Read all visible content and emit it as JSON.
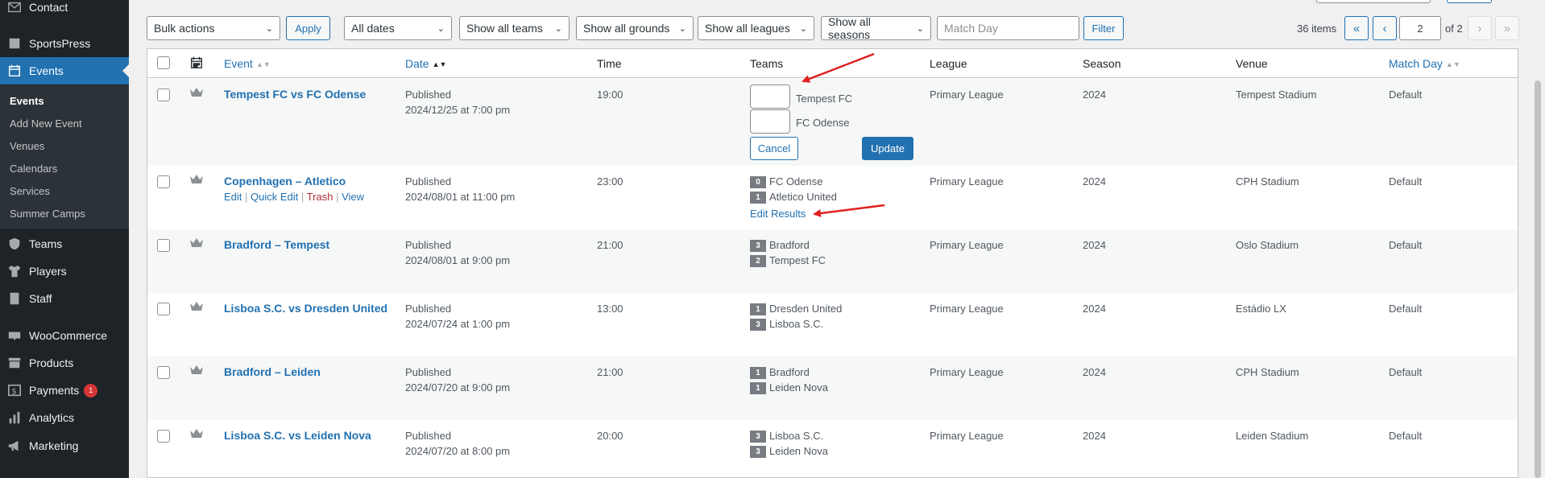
{
  "sidebar": {
    "items": [
      {
        "label": "Contact",
        "icon": "mail-icon"
      },
      {
        "label": "SportsPress",
        "icon": "sportspress-icon"
      },
      {
        "label": "Events",
        "icon": "calendar-icon"
      },
      {
        "label": "Teams",
        "icon": "shield-icon"
      },
      {
        "label": "Players",
        "icon": "shirt-icon"
      },
      {
        "label": "Staff",
        "icon": "id-card-icon"
      },
      {
        "label": "WooCommerce",
        "icon": "woo-icon"
      },
      {
        "label": "Products",
        "icon": "archive-icon"
      },
      {
        "label": "Payments",
        "icon": "dollar-icon",
        "badge": "1"
      },
      {
        "label": "Analytics",
        "icon": "bar-chart-icon"
      },
      {
        "label": "Marketing",
        "icon": "megaphone-icon"
      }
    ],
    "submenu": [
      "Events",
      "Add New Event",
      "Venues",
      "Calendars",
      "Services",
      "Summer Camps"
    ]
  },
  "filters": {
    "bulk_actions": "Bulk actions",
    "apply": "Apply",
    "dates": "All dates",
    "teams": "Show all teams",
    "grounds": "Show all grounds",
    "leagues": "Show all leagues",
    "seasons": "Show all seasons",
    "match_day_placeholder": "Match Day",
    "filter": "Filter"
  },
  "pagination": {
    "items": "36 items",
    "first": "«",
    "prev": "‹",
    "current": "2",
    "of": "of 2",
    "next": "›",
    "last": "»"
  },
  "columns": {
    "event": "Event",
    "date": "Date",
    "time": "Time",
    "teams": "Teams",
    "league": "League",
    "season": "Season",
    "venue": "Venue",
    "match_day": "Match Day"
  },
  "quick_edit": {
    "team1": "Tempest FC",
    "team2": "FC Odense",
    "cancel": "Cancel",
    "update": "Update"
  },
  "row_actions": {
    "edit": "Edit",
    "quick_edit": "Quick Edit",
    "trash": "Trash",
    "view": "View",
    "sep": "|"
  },
  "edit_results": "Edit Results",
  "rows": [
    {
      "event": "Tempest FC vs FC Odense",
      "status": "Published",
      "date": "2024/12/25 at 7:00 pm",
      "time": "19:00",
      "league": "Primary League",
      "season": "2024",
      "venue": "Tempest Stadium",
      "match_day": "Default"
    },
    {
      "event": "Copenhagen – Atletico",
      "status": "Published",
      "date": "2024/08/01 at 11:00 pm",
      "time": "23:00",
      "team1": "FC Odense",
      "score1": "0",
      "team2": "Atletico United",
      "score2": "1",
      "league": "Primary League",
      "season": "2024",
      "venue": "CPH Stadium",
      "match_day": "Default"
    },
    {
      "event": "Bradford – Tempest",
      "status": "Published",
      "date": "2024/08/01 at 9:00 pm",
      "time": "21:00",
      "team1": "Bradford",
      "score1": "3",
      "team2": "Tempest FC",
      "score2": "2",
      "league": "Primary League",
      "season": "2024",
      "venue": "Oslo Stadium",
      "match_day": "Default"
    },
    {
      "event": "Lisboa S.C. vs Dresden United",
      "status": "Published",
      "date": "2024/07/24 at 1:00 pm",
      "time": "13:00",
      "team1": "Dresden United",
      "score1": "1",
      "team2": "Lisboa S.C.",
      "score2": "3",
      "league": "Primary League",
      "season": "2024",
      "venue": "Estádio LX",
      "match_day": "Default"
    },
    {
      "event": "Bradford – Leiden",
      "status": "Published",
      "date": "2024/07/20 at 9:00 pm",
      "time": "21:00",
      "team1": "Bradford",
      "score1": "1",
      "team2": "Leiden Nova",
      "score2": "1",
      "league": "Primary League",
      "season": "2024",
      "venue": "CPH Stadium",
      "match_day": "Default"
    },
    {
      "event": "Lisboa S.C. vs Leiden Nova",
      "status": "Published",
      "date": "2024/07/20 at 8:00 pm",
      "time": "20:00",
      "team1": "Lisboa S.C.",
      "score1": "3",
      "team2": "Leiden Nova",
      "score2": "3",
      "league": "Primary League",
      "season": "2024",
      "venue": "Leiden Stadium",
      "match_day": "Default"
    }
  ],
  "colors": {
    "accent": "#2271b1",
    "sidebar_bg": "#1d2327",
    "annotation_arrow": "#e02020"
  }
}
